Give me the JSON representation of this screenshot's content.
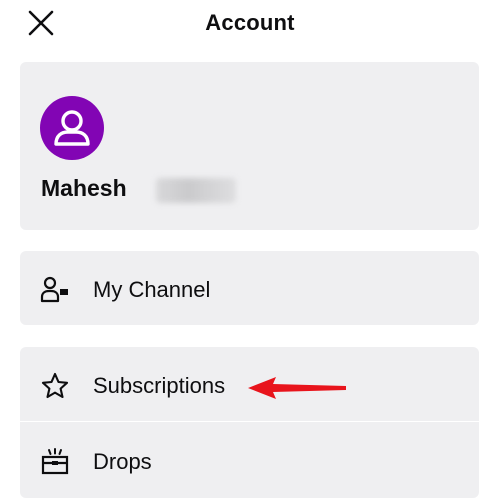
{
  "header": {
    "title": "Account",
    "close_icon": "close-icon"
  },
  "profile": {
    "username": "Mahesh",
    "avatar_icon": "user-avatar-icon",
    "avatar_color": "#8205b4"
  },
  "channel": {
    "label": "My Channel",
    "icon": "my-channel-icon"
  },
  "menu": {
    "items": [
      {
        "label": "Subscriptions",
        "icon": "star-icon"
      },
      {
        "label": "Drops",
        "icon": "drops-icon"
      }
    ]
  },
  "annotation": {
    "arrow_color": "#e8141c"
  }
}
